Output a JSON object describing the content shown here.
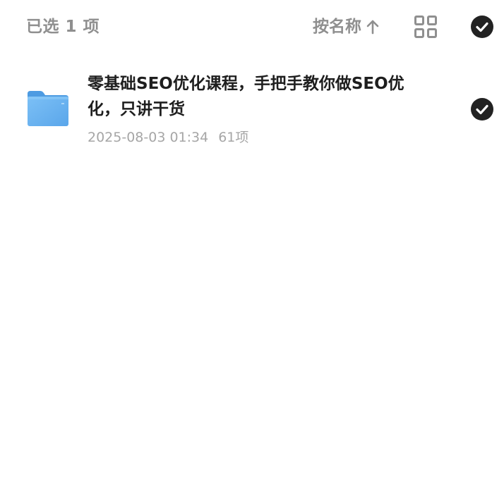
{
  "header": {
    "selected_label": "已选 1 项",
    "sort_label": "按名称",
    "sort_direction_icon": "arrow-up-icon",
    "view_toggle_icon": "grid-view-icon",
    "select_all_icon": "check-circle-icon"
  },
  "files": [
    {
      "icon": "folder-icon",
      "name": "零基础SEO优化课程，手把手教你做SEO优化，只讲干货",
      "date": "2025-08-03 01:34",
      "count": "61项",
      "selected": true
    }
  ],
  "colors": {
    "text_primary": "#1e1e1e",
    "text_secondary": "#8f8f8f",
    "meta": "#a6a6a6",
    "check_fill": "#222222",
    "folder_blue": "#6fb6f2"
  }
}
